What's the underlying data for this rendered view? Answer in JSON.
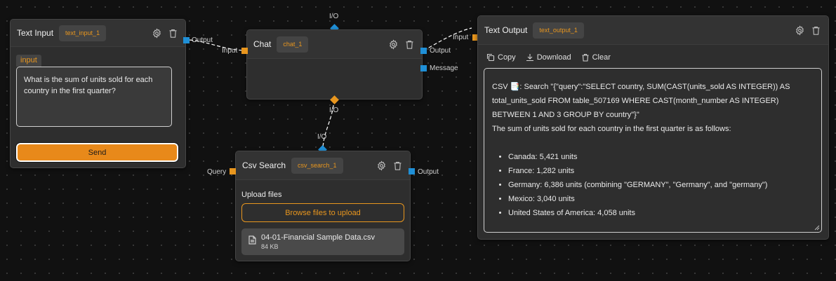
{
  "canvas": {
    "accent_orange": "#e8961e",
    "accent_blue": "#1f8fd6",
    "background": "#111111"
  },
  "top_io_label": "I/O",
  "nodes": {
    "text_input": {
      "title": "Text Input",
      "id": "text_input_1",
      "output_port": "Output",
      "input_tag": "input",
      "input_value": "What is the sum of units sold for each country in the first quarter?",
      "send_label": "Send",
      "icons": [
        "gear-icon",
        "trash-icon"
      ]
    },
    "chat": {
      "title": "Chat",
      "id": "chat_1",
      "input_port": "Input",
      "output_port": "Output",
      "message_port": "Message",
      "io_top": "I/O",
      "io_bottom": "I/O"
    },
    "csv_search": {
      "title": "Csv Search",
      "id": "csv_search_1",
      "io_top": "I/O",
      "query_port": "Query",
      "output_port": "Output",
      "upload_label": "Upload files",
      "browse_label": "Browse files to upload",
      "file": {
        "name": "04-01-Financial Sample Data.csv",
        "size": "84 KB"
      }
    },
    "text_output": {
      "title": "Text Output",
      "id": "text_output_1",
      "input_port": "Input",
      "toolbar": {
        "copy": "Copy",
        "download": "Download",
        "clear": "Clear"
      },
      "content": {
        "line1": "CSV 📑: Search \"{\"query\":\"SELECT country, SUM(CAST(units_sold AS INTEGER)) AS",
        "line2": "total_units_sold FROM table_507169 WHERE CAST(month_number AS INTEGER)",
        "line3": "BETWEEN 1 AND 3 GROUP BY country\"}\"",
        "summary": "The sum of units sold for each country in the first quarter is as follows:",
        "items": [
          "Canada: 5,421 units",
          "France: 1,282 units",
          "Germany: 6,386 units (combining \"GERMANY\", \"Germany\", and \"germany\")",
          "Mexico: 3,040 units",
          "United States of America: 4,058 units"
        ]
      }
    }
  }
}
